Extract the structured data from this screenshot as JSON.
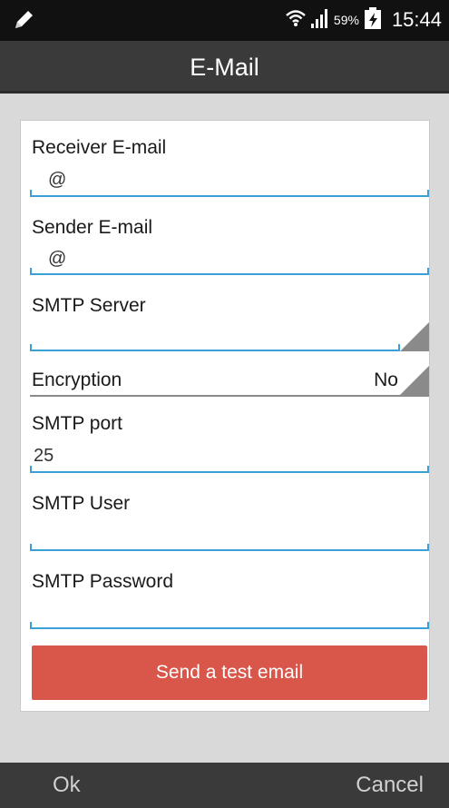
{
  "status_bar": {
    "battery_percent": "59%",
    "time": "15:44",
    "icons": [
      "pencil-icon",
      "wifi-icon",
      "signal-icon",
      "battery-charging-icon"
    ]
  },
  "title": "E-Mail",
  "form": {
    "receiver_label": "Receiver E-mail",
    "receiver_value": "@",
    "sender_label": "Sender E-mail",
    "sender_value": "@",
    "smtp_server_label": "SMTP Server",
    "smtp_server_value": "",
    "encryption_label": "Encryption",
    "encryption_value": "No",
    "smtp_port_label": "SMTP port",
    "smtp_port_value": "25",
    "smtp_user_label": "SMTP User",
    "smtp_user_value": "",
    "smtp_password_label": "SMTP Password",
    "smtp_password_value": ""
  },
  "test_button": "Send a test email",
  "accent_color": "#3aa0d6",
  "button_color": "#d9564b",
  "footer": {
    "ok": "Ok",
    "cancel": "Cancel"
  }
}
